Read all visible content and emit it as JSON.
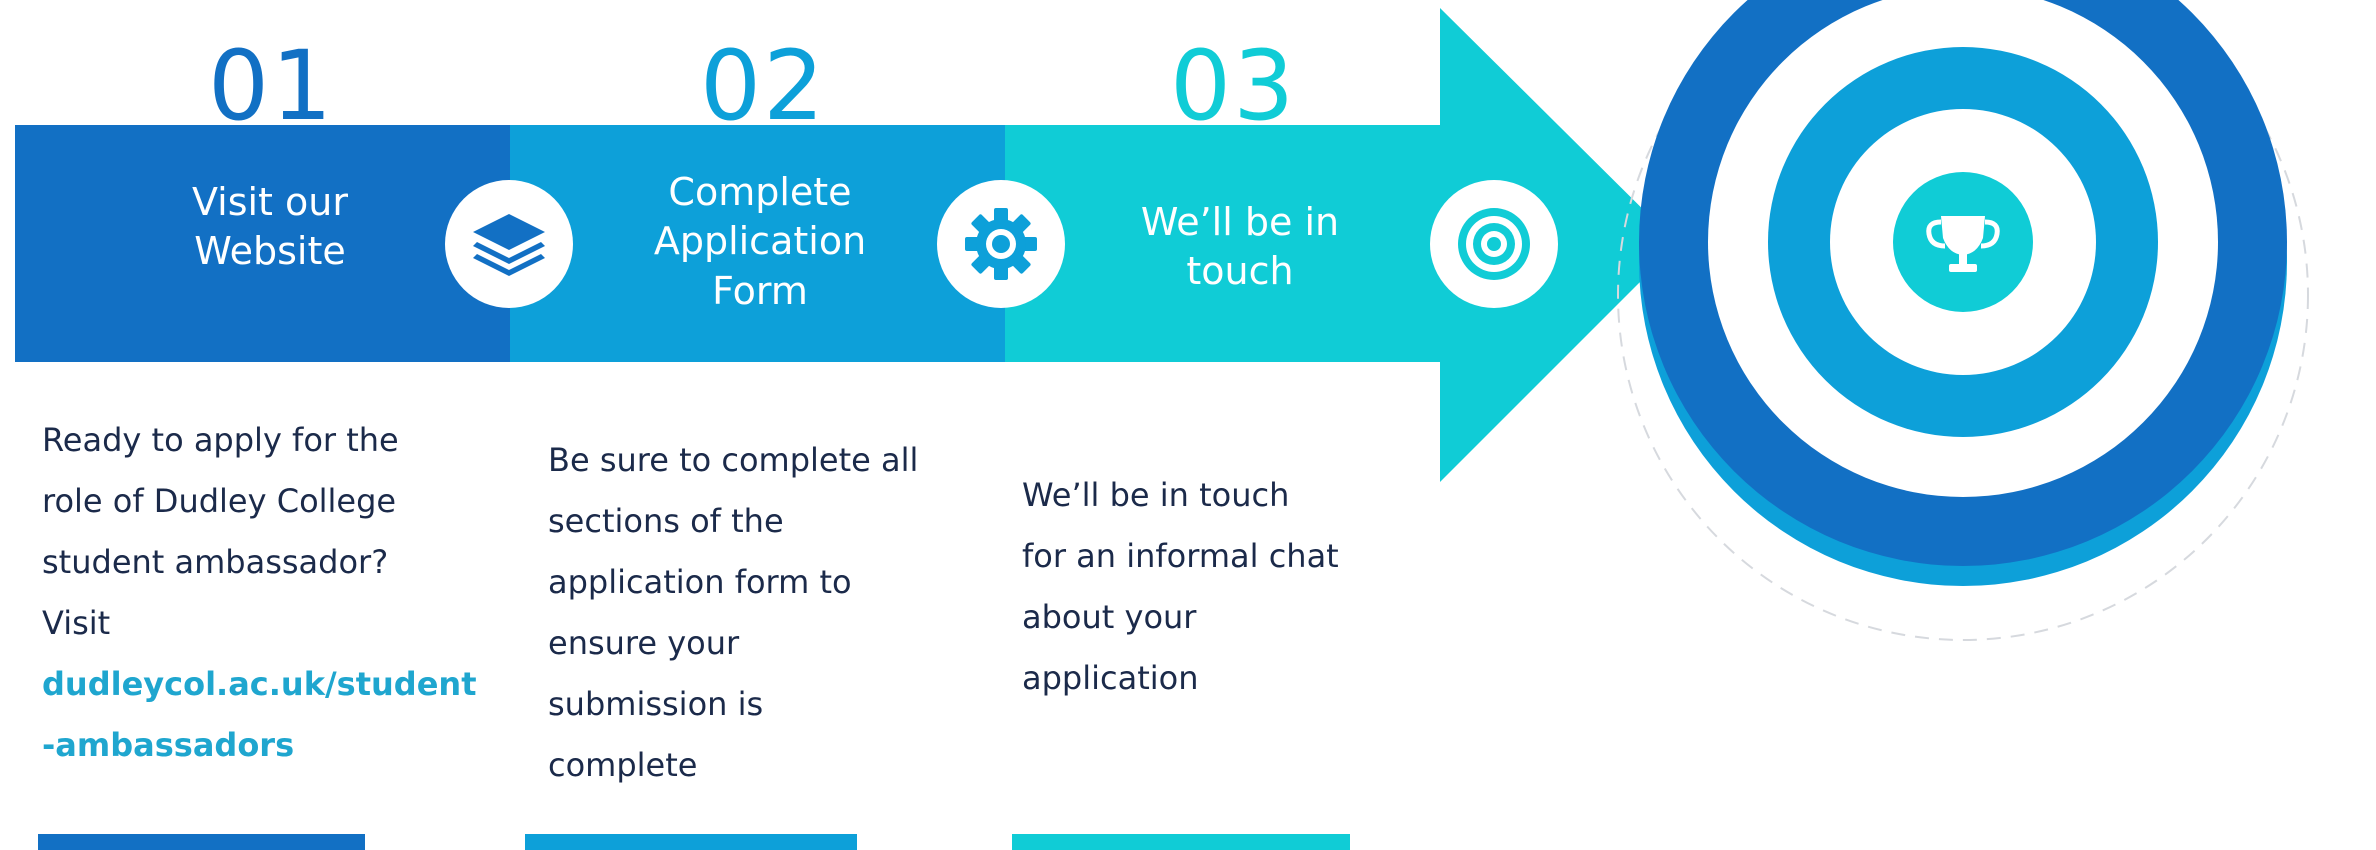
{
  "colors": {
    "step1": "#1270c4",
    "step2": "#0da0d9",
    "step3": "#10ccd6",
    "body_text": "#1b2a4a",
    "link": "#1fa6cf"
  },
  "steps": [
    {
      "number": "01",
      "title_lines": [
        "Visit our",
        "Website"
      ],
      "icon": "layers-icon",
      "description_lines": [
        "Ready to apply for the",
        "role of Dudley College",
        "student ambassador?",
        "Visit"
      ],
      "link_lines": [
        "dudleycol.ac.uk/student",
        "-ambassadors"
      ]
    },
    {
      "number": "02",
      "title_lines": [
        "Complete",
        "Application",
        "Form"
      ],
      "icon": "gear-icon",
      "description_lines": [
        "Be sure to complete all",
        "sections of the",
        "application form to",
        "ensure your",
        "submission is",
        "complete"
      ]
    },
    {
      "number": "03",
      "title_lines": [
        "We’ll be in",
        "touch"
      ],
      "icon": "target-icon",
      "description_lines": [
        "We’ll be in  touch",
        "for an informal chat",
        "about your",
        "application"
      ]
    }
  ],
  "goal": {
    "icon": "trophy-icon"
  }
}
